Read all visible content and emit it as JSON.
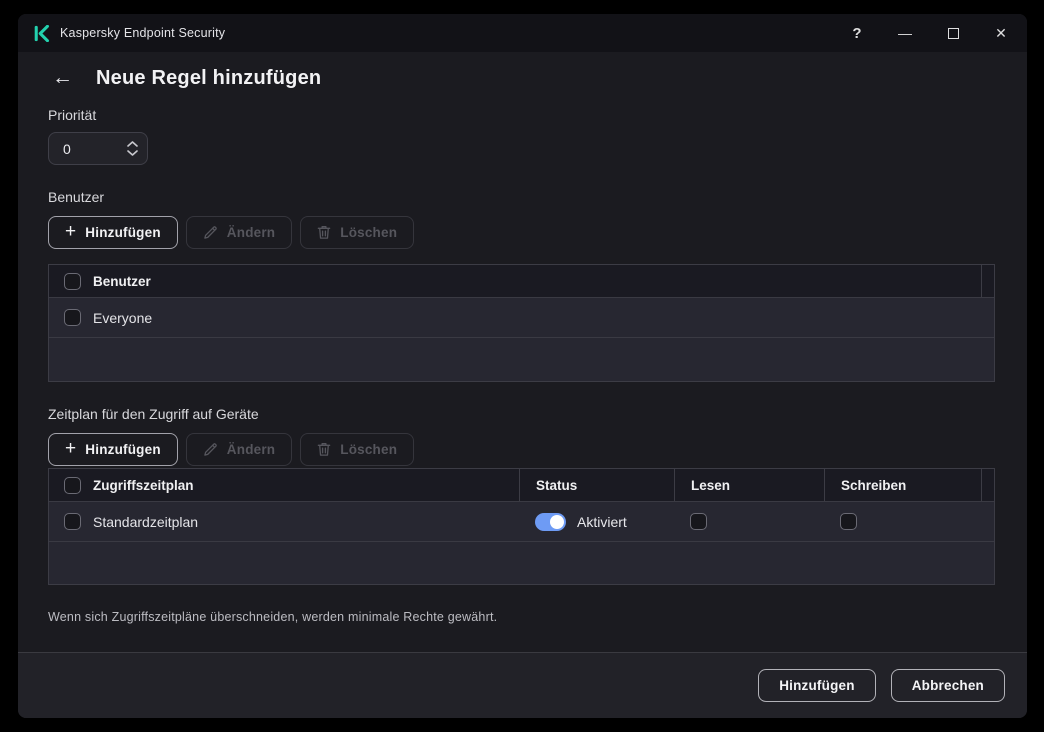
{
  "window": {
    "app_title": "Kaspersky Endpoint Security",
    "icons": {
      "help": "?",
      "minimize": "—",
      "close": "✕",
      "back": "←"
    }
  },
  "page": {
    "title": "Neue Regel hinzufügen"
  },
  "priority": {
    "label": "Priorität",
    "value": "0"
  },
  "users_section": {
    "label": "Benutzer",
    "toolbar": {
      "add": "Hinzufügen",
      "edit": "Ändern",
      "delete": "Löschen",
      "plus": "+"
    },
    "table": {
      "header": "Benutzer",
      "rows": [
        {
          "name": "Everyone",
          "checked": false
        }
      ]
    }
  },
  "schedule_section": {
    "label": "Zeitplan für den Zugriff auf Geräte",
    "toolbar": {
      "add": "Hinzufügen",
      "edit": "Ändern",
      "delete": "Löschen",
      "plus": "+"
    },
    "table": {
      "headers": {
        "schedule": "Zugriffszeitplan",
        "status": "Status",
        "read": "Lesen",
        "write": "Schreiben"
      },
      "rows": [
        {
          "name": "Standardzeitplan",
          "status_label": "Aktiviert",
          "status_on": true,
          "read": false,
          "write": false
        }
      ]
    }
  },
  "note": "Wenn sich Zugriffszeitpläne überschneiden, werden minimale Rechte gewährt.",
  "footer": {
    "add": "Hinzufügen",
    "cancel": "Abbrechen"
  },
  "colors": {
    "brand_green": "#23d1ae",
    "toggle_blue": "#6e9bf4",
    "window_bg": "#1b1b20",
    "titlebar_bg": "#121217"
  }
}
